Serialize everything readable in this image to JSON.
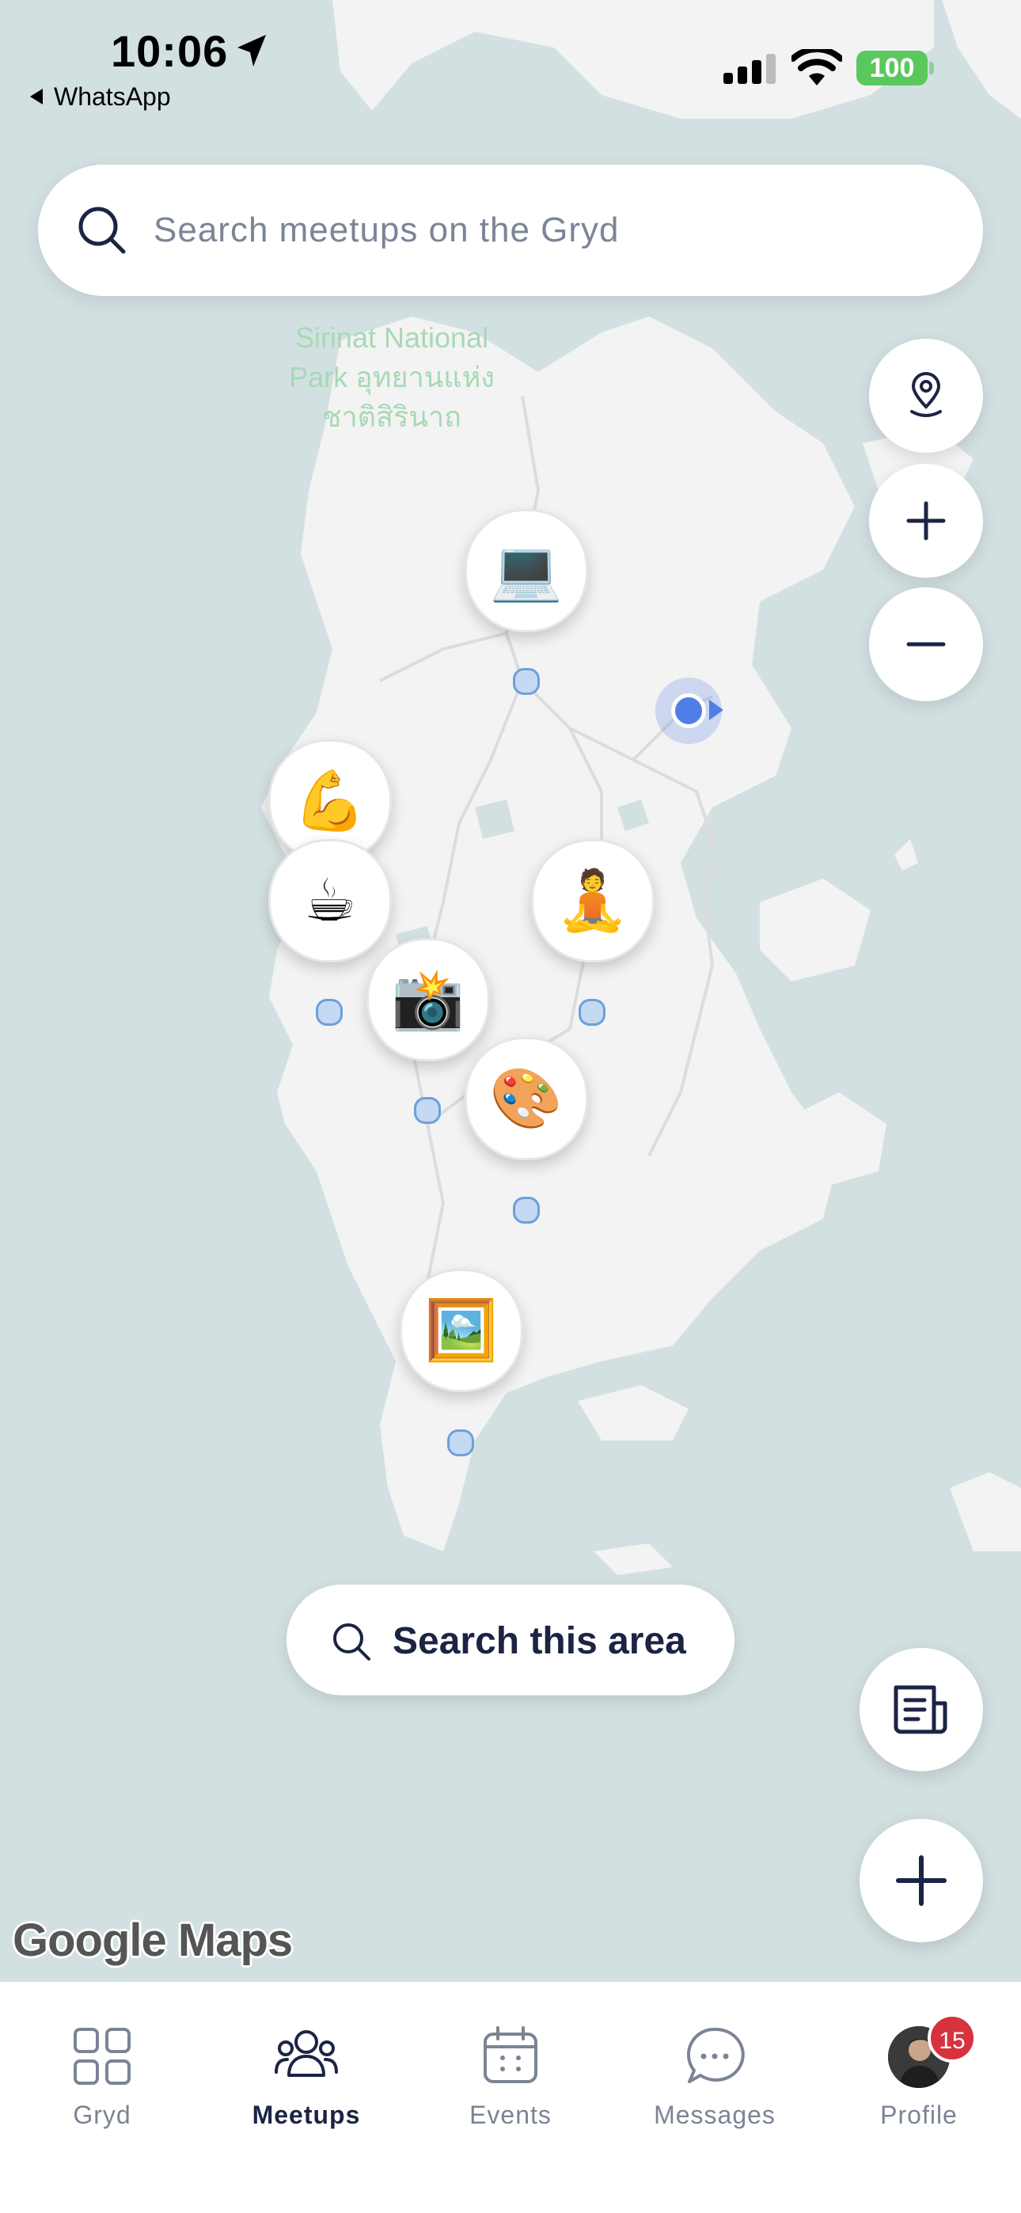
{
  "status_bar": {
    "time": "10:06",
    "back_app": "WhatsApp",
    "battery": "100",
    "battery_color": "#5bc85e"
  },
  "search": {
    "placeholder": "Search meetups on the Gryd"
  },
  "map": {
    "park_label": "Sirinat National Park อุทยานแห่งชาติสิรินาถ",
    "attribution": "Google Maps",
    "markers": [
      {
        "name": "laptop",
        "emoji": "💻"
      },
      {
        "name": "flexed-biceps",
        "emoji": "💪"
      },
      {
        "name": "hot-beverage",
        "emoji": "☕"
      },
      {
        "name": "person-lotus",
        "emoji": "🧘"
      },
      {
        "name": "camera-flash",
        "emoji": "📸"
      },
      {
        "name": "artist-palette",
        "emoji": "🎨"
      },
      {
        "name": "framed-picture",
        "emoji": "🖼️"
      }
    ],
    "controls": [
      "my-location-icon",
      "zoom-in-icon",
      "zoom-out-icon"
    ]
  },
  "search_area": {
    "label": "Search this area"
  },
  "fabs": [
    "list-view-icon",
    "add-meetup-icon"
  ],
  "tabs": [
    {
      "label": "Gryd",
      "icon": "grid-icon",
      "active": false
    },
    {
      "label": "Meetups",
      "icon": "people-icon",
      "active": true
    },
    {
      "label": "Events",
      "icon": "calendar-icon",
      "active": false
    },
    {
      "label": "Messages",
      "icon": "chat-icon",
      "active": false
    },
    {
      "label": "Profile",
      "icon": "avatar",
      "active": false
    }
  ],
  "profile_badge": "15",
  "colors": {
    "accent": "#1b2444",
    "inactive": "#7b8494",
    "badge": "#d7323e",
    "water": "#d3e0e2",
    "land": "#f3f3f3",
    "user_location": "#4f7fe6"
  }
}
